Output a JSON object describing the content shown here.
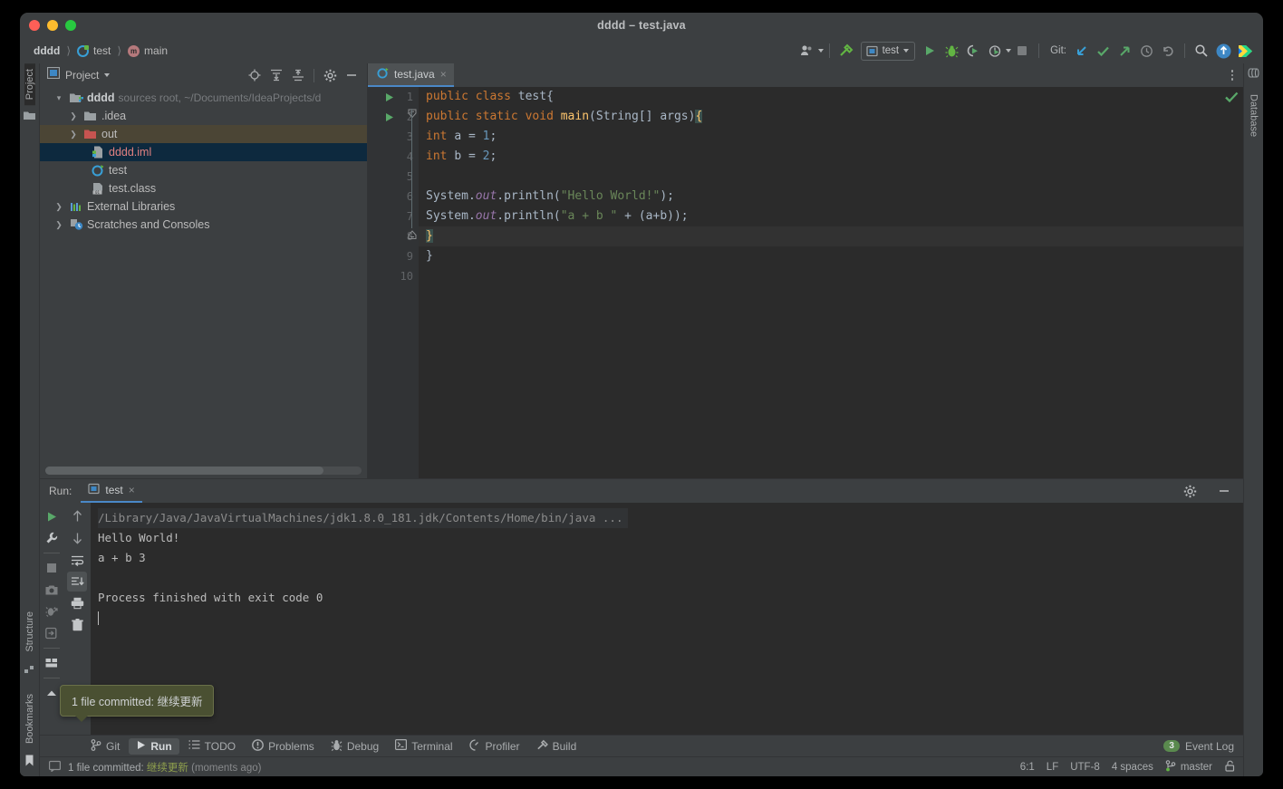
{
  "window": {
    "title": "dddd – test.java",
    "traffic_lights": [
      "close",
      "minimize",
      "maximize"
    ]
  },
  "breadcrumbs": [
    {
      "label": "dddd",
      "icon": "project-icon"
    },
    {
      "label": "test",
      "icon": "class-icon"
    },
    {
      "label": "main",
      "icon": "method-icon"
    }
  ],
  "toolbar": {
    "profile_icon": "user-profile-icon",
    "build_icon": "hammer-icon",
    "run_config": "test",
    "run_icon": "run-icon",
    "debug_icon": "debug-icon",
    "coverage_icon": "run-with-coverage-icon",
    "profiler_icon": "profiler-icon",
    "stop_icon": "stop-icon",
    "git_label": "Git:",
    "update_icon": "update-project-icon",
    "commit_icon": "commit-icon",
    "push_icon": "push-icon",
    "history_icon": "history-icon",
    "rollback_icon": "rollback-icon",
    "search_icon": "search-everywhere-icon",
    "account_icon": "account-icon",
    "ide_icon": "ide-logo-icon"
  },
  "left_rail": {
    "tabs": [
      "Project",
      "Structure",
      "Bookmarks"
    ],
    "active": "Project",
    "bottom_icon": "bookmark-flag-icon"
  },
  "right_rail": {
    "tabs": [
      "Database"
    ]
  },
  "project_panel": {
    "title": "Project",
    "header_icons": [
      "locate-icon",
      "expand-all-icon",
      "collapse-all-icon",
      "settings-gear-icon",
      "hide-icon"
    ],
    "tree": [
      {
        "indent": 0,
        "arrow": "⌄",
        "icon": "module-folder-icon",
        "label": "dddd",
        "bold": true,
        "suffix": "sources root,  ~/Documents/IdeaProjects/d",
        "state": "normal"
      },
      {
        "indent": 1,
        "arrow": "›",
        "icon": "folder-icon",
        "label": ".idea",
        "bold": false,
        "suffix": "",
        "state": "normal"
      },
      {
        "indent": 1,
        "arrow": "›",
        "icon": "out-folder-icon",
        "label": "out",
        "bold": false,
        "suffix": "",
        "state": "highlighted"
      },
      {
        "indent": 2,
        "arrow": "",
        "icon": "iml-file-icon",
        "label": "dddd.iml",
        "bold": false,
        "suffix": "",
        "state": "selected"
      },
      {
        "indent": 2,
        "arrow": "",
        "icon": "class-icon",
        "label": "test",
        "bold": false,
        "suffix": "",
        "state": "normal"
      },
      {
        "indent": 2,
        "arrow": "",
        "icon": "classfile-icon",
        "label": "test.class",
        "bold": false,
        "suffix": "",
        "state": "normal"
      },
      {
        "indent": 0,
        "arrow": "›",
        "icon": "libraries-icon",
        "label": "External Libraries",
        "bold": false,
        "suffix": "",
        "state": "normal"
      },
      {
        "indent": 0,
        "arrow": "›",
        "icon": "scratches-icon",
        "label": "Scratches and Consoles",
        "bold": false,
        "suffix": "",
        "state": "normal"
      }
    ]
  },
  "editor": {
    "tab": {
      "label": "test.java",
      "icon": "java-class-icon",
      "close": "×"
    },
    "kebab_icon": "more-options-icon",
    "inspection_icon": "inspections-ok-checkmark",
    "gutter_numbers": [
      "1",
      "2",
      "3",
      "4",
      "5",
      "6",
      "7",
      "8",
      "9",
      "10"
    ],
    "run_markers": {
      "1": "run-class-gutter-icon",
      "2": "run-method-gutter-icon"
    },
    "fold_markers": {
      "2": "fold-collapse-icon",
      "8": "fold-end-icon"
    },
    "current_line": 8,
    "lines": [
      {
        "n": 1,
        "tokens": [
          {
            "t": "public ",
            "c": "kw"
          },
          {
            "t": "class ",
            "c": "kw"
          },
          {
            "t": "test{",
            "c": ""
          }
        ]
      },
      {
        "n": 2,
        "tokens": [
          {
            "t": "public ",
            "c": "kw"
          },
          {
            "t": "static ",
            "c": "kw"
          },
          {
            "t": "void ",
            "c": "kw"
          },
          {
            "t": "main",
            "c": "fn"
          },
          {
            "t": "(String[] args)",
            "c": ""
          },
          {
            "t": "{",
            "c": "brace-hl"
          }
        ]
      },
      {
        "n": 3,
        "tokens": [
          {
            "t": "int ",
            "c": "kw"
          },
          {
            "t": "a = ",
            "c": ""
          },
          {
            "t": "1",
            "c": "num"
          },
          {
            "t": ";",
            "c": ""
          }
        ]
      },
      {
        "n": 4,
        "tokens": [
          {
            "t": "int ",
            "c": "kw"
          },
          {
            "t": "b = ",
            "c": ""
          },
          {
            "t": "2",
            "c": "num"
          },
          {
            "t": ";",
            "c": ""
          }
        ]
      },
      {
        "n": 5,
        "tokens": []
      },
      {
        "n": 6,
        "tokens": [
          {
            "t": "System.",
            "c": ""
          },
          {
            "t": "out",
            "c": "fld"
          },
          {
            "t": ".println(",
            "c": ""
          },
          {
            "t": "\"Hello World!\"",
            "c": "str"
          },
          {
            "t": ");",
            "c": ""
          }
        ]
      },
      {
        "n": 7,
        "tokens": [
          {
            "t": "System.",
            "c": ""
          },
          {
            "t": "out",
            "c": "fld"
          },
          {
            "t": ".println(",
            "c": ""
          },
          {
            "t": "\"a + b \"",
            "c": "str"
          },
          {
            "t": " + (a+b));",
            "c": ""
          }
        ]
      },
      {
        "n": 8,
        "tokens": [
          {
            "t": "}",
            "c": "brace-hl"
          }
        ]
      },
      {
        "n": 9,
        "tokens": [
          {
            "t": "}",
            "c": ""
          }
        ]
      },
      {
        "n": 10,
        "tokens": []
      }
    ]
  },
  "run_panel": {
    "label": "Run:",
    "tab": {
      "label": "test",
      "icon": "run-config-icon",
      "close": "×"
    },
    "settings_icon": "settings-gear-icon",
    "minimize_icon": "hide-icon",
    "tool_buttons_col1": [
      "rerun-icon",
      "wrench-icon",
      "stop-icon",
      "camera-icon",
      "thread-dump-icon",
      "export-icon",
      "layout-icon"
    ],
    "tool_buttons_col2": [
      "up-arrow-icon",
      "down-arrow-icon",
      "soft-wrap-icon",
      "scroll-to-end-icon",
      "print-icon",
      "trash-icon"
    ],
    "active_tool": "scroll-to-end-icon",
    "console": [
      {
        "text": "/Library/Java/JavaVirtualMachines/jdk1.8.0_181.jdk/Contents/Home/bin/java ...",
        "kind": "path"
      },
      {
        "text": "Hello World!",
        "kind": "out"
      },
      {
        "text": "a + b 3",
        "kind": "out"
      },
      {
        "text": "",
        "kind": "out"
      },
      {
        "text": "Process finished with exit code 0",
        "kind": "out"
      }
    ]
  },
  "tooltip": {
    "text": "1 file committed: 继续更新"
  },
  "bottom_tabs": {
    "items": [
      {
        "label": "Git",
        "icon": "git-branch-icon",
        "active": false
      },
      {
        "label": "Run",
        "icon": "run-icon",
        "active": true
      },
      {
        "label": "TODO",
        "icon": "todo-list-icon",
        "active": false
      },
      {
        "label": "Problems",
        "icon": "problems-icon",
        "active": false
      },
      {
        "label": "Debug",
        "icon": "debug-bug-icon",
        "active": false
      },
      {
        "label": "Terminal",
        "icon": "terminal-icon",
        "active": false
      },
      {
        "label": "Profiler",
        "icon": "profiler-gauge-icon",
        "active": false
      },
      {
        "label": "Build",
        "icon": "hammer-icon",
        "active": false
      }
    ],
    "event_log": {
      "label": "Event Log",
      "count": "3"
    }
  },
  "status_bar": {
    "message_icon": "message-balloon-icon",
    "message_prefix": "1 file committed: ",
    "message_zh": "继续更新",
    "message_suffix": " (moments ago)",
    "caret_position": "6:1",
    "line_separator": "LF",
    "encoding": "UTF-8",
    "indent": "4 spaces",
    "branch": "master",
    "branch_icon": "git-branch-icon",
    "lock_icon": "unlocked-icon"
  },
  "colors": {
    "chrome": "#3c3f41",
    "editor_bg": "#2b2b2b",
    "accent_blue": "#4a88c7",
    "green": "#62b543",
    "selection_blue": "#0d293e",
    "highlight_brown": "#4b4535",
    "tooltip_bg": "#4a5032"
  }
}
